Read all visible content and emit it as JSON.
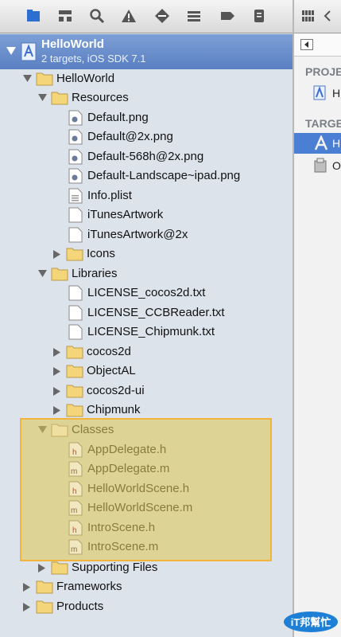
{
  "navigator": {
    "toolbar_icons": [
      "folder-icon",
      "hierarchy-icon",
      "search-icon",
      "warning-icon",
      "breakpoint-icon",
      "list-icon",
      "tag-icon",
      "log-icon"
    ],
    "project": {
      "name": "HelloWorld",
      "subtitle": "2 targets, iOS SDK 7.1"
    },
    "tree": {
      "helloworld": "HelloWorld",
      "resources": "Resources",
      "default_png": "Default.png",
      "default2x": "Default@2x.png",
      "default568": "Default-568h@2x.png",
      "default_landscape": "Default-Landscape~ipad.png",
      "info_plist": "Info.plist",
      "itunes": "iTunesArtwork",
      "itunes2x": "iTunesArtwork@2x",
      "icons": "Icons",
      "libraries": "Libraries",
      "lic_cocos": "LICENSE_cocos2d.txt",
      "lic_ccb": "LICENSE_CCBReader.txt",
      "lic_chip": "LICENSE_Chipmunk.txt",
      "cocos2d": "cocos2d",
      "objectal": "ObjectAL",
      "cocos2dui": "cocos2d-ui",
      "chipmunk": "Chipmunk",
      "classes": "Classes",
      "appdelegate_h": "AppDelegate.h",
      "appdelegate_m": "AppDelegate.m",
      "hws_h": "HelloWorldScene.h",
      "hws_m": "HelloWorldScene.m",
      "intro_h": "IntroScene.h",
      "intro_m": "IntroScene.m",
      "supporting": "Supporting Files",
      "frameworks": "Frameworks",
      "products": "Products"
    }
  },
  "editor": {
    "section_project": "PROJE",
    "project_item": "H",
    "section_targets": "TARGE",
    "target_1": "H",
    "target_2": "O"
  },
  "watermark": {
    "text": "iT邦幫忙"
  },
  "colors": {
    "selection": "#4a7fd4",
    "highlight_border": "#f2b43a",
    "highlight_fill": "#dccd78"
  }
}
